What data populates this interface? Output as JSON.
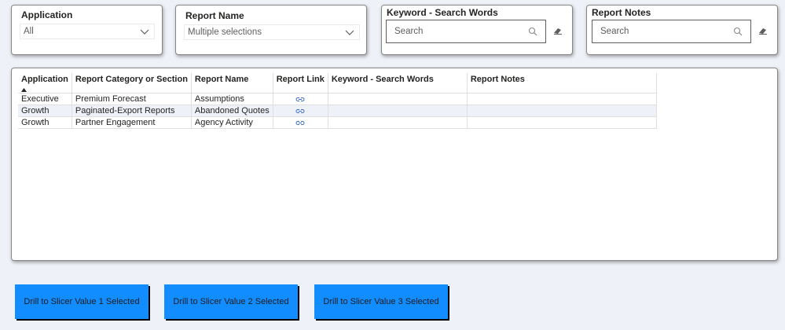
{
  "slicers": {
    "application": {
      "title": "Application",
      "value": "All"
    },
    "report_name": {
      "title": "Report Name",
      "value": "Multiple selections"
    },
    "keyword": {
      "title": "Keyword - Search Words",
      "placeholder": "Search"
    },
    "report_notes": {
      "title": "Report Notes",
      "placeholder": "Search"
    }
  },
  "table": {
    "columns": [
      "Application",
      "Report Category or Section",
      "Report Name",
      "Report Link",
      "Keyword - Search Words",
      "Report Notes"
    ],
    "rows": [
      [
        "Executive",
        "Premium Forecast",
        "Assumptions",
        "",
        "",
        ""
      ],
      [
        "Growth",
        "Paginated-Export Reports",
        "Abandoned Quotes",
        "",
        "",
        ""
      ],
      [
        "Growth",
        "Partner Engagement",
        "Agency Activity",
        "",
        "",
        ""
      ]
    ],
    "sort_icon": "sort-up-icon",
    "link_icon": "link-icon"
  },
  "buttons": [
    {
      "label": "Drill to Slicer Value 1 Selected"
    },
    {
      "label": "Drill to Slicer Value 2 Selected"
    },
    {
      "label": "Drill to Slicer Value 3 Selected"
    }
  ],
  "colors": {
    "accent": "#118dff",
    "background": "#eef1f7",
    "card": "#ffffff"
  }
}
